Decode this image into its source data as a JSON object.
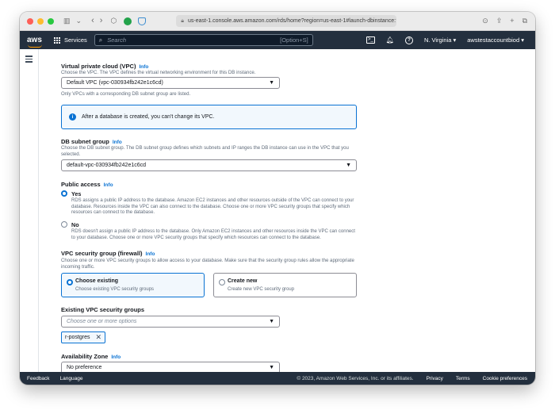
{
  "browser": {
    "url": "us-east-1.console.aws.amazon.com/rds/home?region=us-east-1#launch-dbinstance:"
  },
  "header": {
    "logo": "aws",
    "services_label": "Services",
    "search_placeholder": "Search",
    "search_shortcut": "[Option+S]",
    "region": "N. Virginia",
    "account": "awstestaccountbiod"
  },
  "vpc": {
    "label": "Virtual private cloud (VPC)",
    "info": "Info",
    "description": "Choose the VPC. The VPC defines the virtual networking environment for this DB instance.",
    "selected": "Default VPC (vpc-030934fb242e1c6cd)",
    "note": "Only VPCs with a corresponding DB subnet group are listed."
  },
  "alert": {
    "icon": "i",
    "text": "After a database is created, you can't change its VPC."
  },
  "subnet": {
    "label": "DB subnet group",
    "info": "Info",
    "description": "Choose the DB subnet group. The DB subnet group defines which subnets and IP ranges the DB instance can use in the VPC that you selected.",
    "selected": "default-vpc-030934fb242e1c6cd"
  },
  "public_access": {
    "label": "Public access",
    "info": "Info",
    "options": [
      {
        "label": "Yes",
        "description": "RDS assigns a public IP address to the database. Amazon EC2 instances and other resources outside of the VPC can connect to your database. Resources inside the VPC can also connect to the database. Choose one or more VPC security groups that specify which resources can connect to the database.",
        "selected": true
      },
      {
        "label": "No",
        "description": "RDS doesn't assign a public IP address to the database. Only Amazon EC2 instances and other resources inside the VPC can connect to your database. Choose one or more VPC security groups that specify which resources can connect to the database.",
        "selected": false
      }
    ]
  },
  "security_group": {
    "label": "VPC security group (firewall)",
    "info": "Info",
    "description": "Choose one or more VPC security groups to allow access to your database. Make sure that the security group rules allow the appropriate incoming traffic.",
    "tiles": [
      {
        "label": "Choose existing",
        "description": "Choose existing VPC security groups",
        "selected": true
      },
      {
        "label": "Create new",
        "description": "Create new VPC security group",
        "selected": false
      }
    ]
  },
  "existing_groups": {
    "label": "Existing VPC security groups",
    "placeholder": "Choose one or more options",
    "token": "r-postgres"
  },
  "availability_zone": {
    "label": "Availability Zone",
    "info": "Info",
    "selected": "No preference"
  },
  "footer": {
    "feedback": "Feedback",
    "language": "Language",
    "copyright": "© 2023, Amazon Web Services, Inc. or its affiliates.",
    "privacy": "Privacy",
    "terms": "Terms",
    "cookies": "Cookie preferences"
  },
  "colors": {
    "nav_bg": "#232f3e",
    "link": "#0972d3",
    "accent": "#ff9900"
  }
}
